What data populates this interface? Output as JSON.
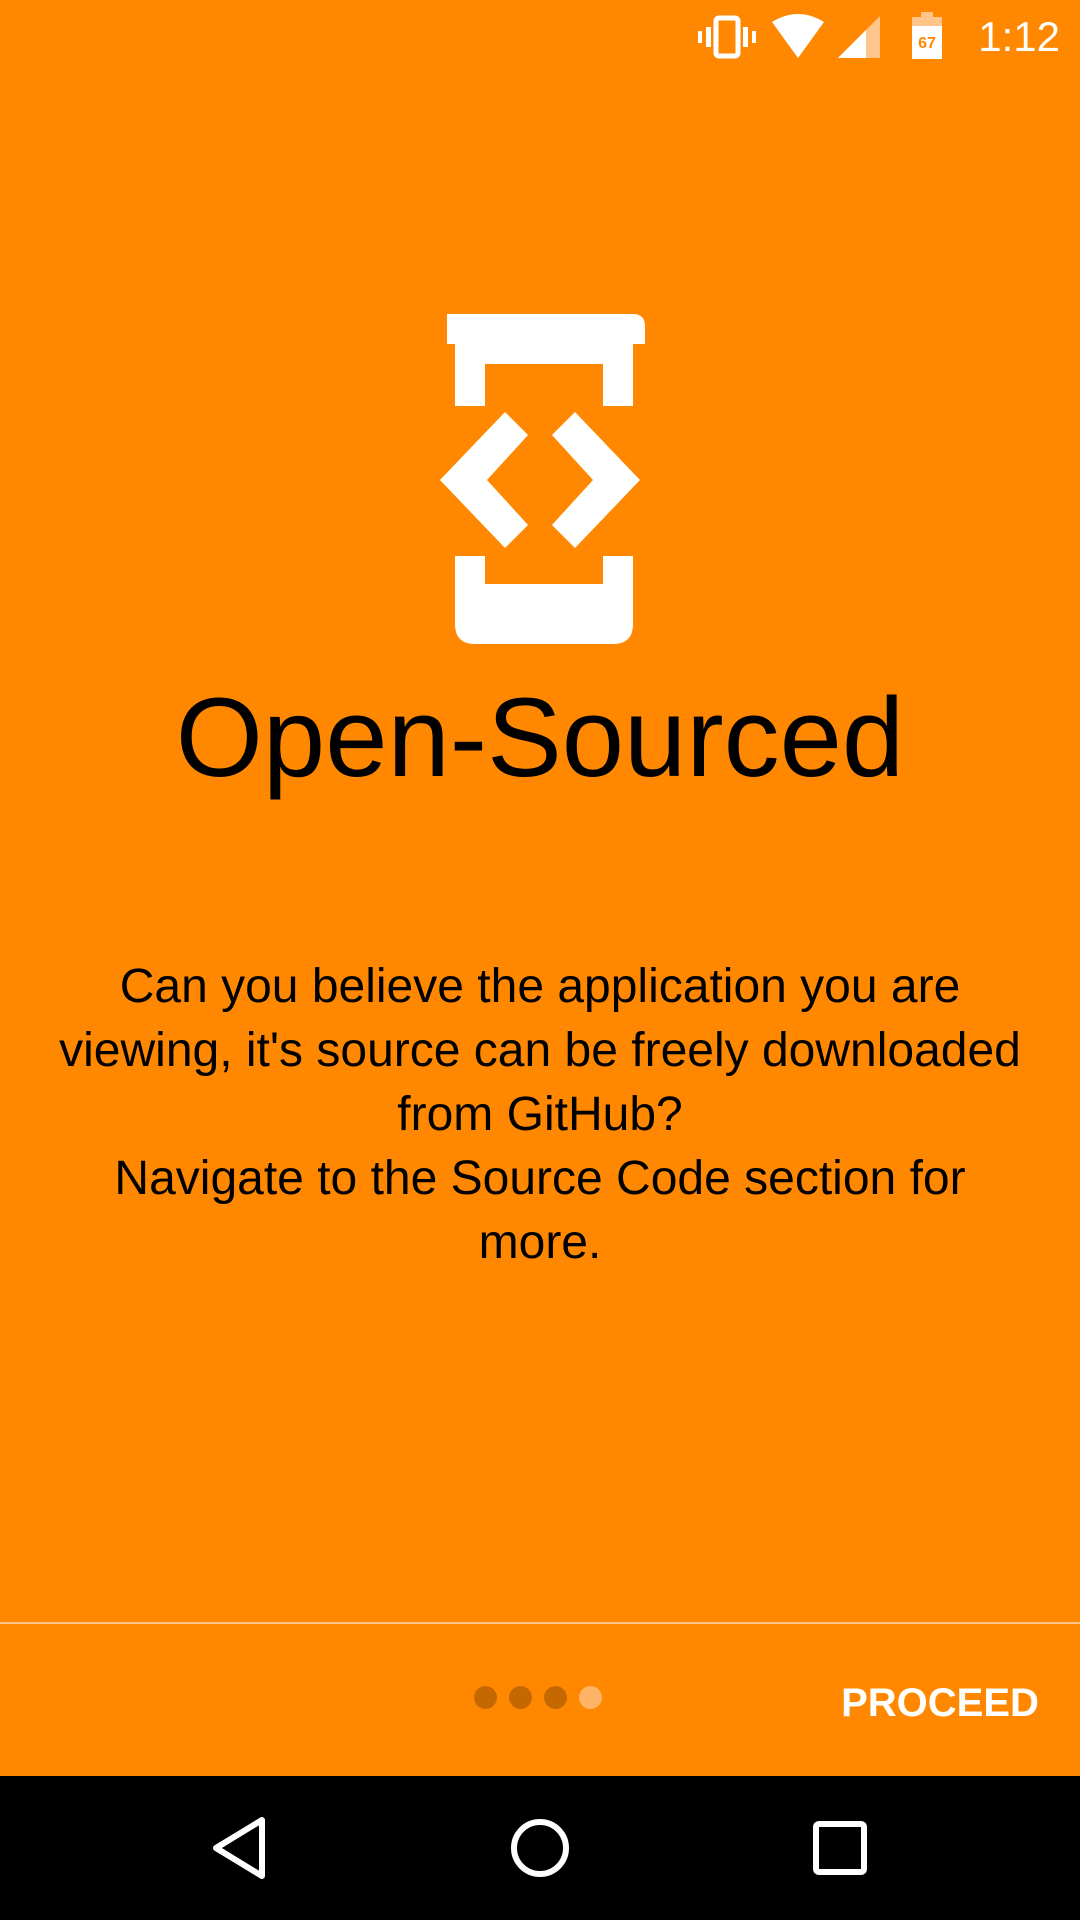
{
  "status_bar": {
    "time": "1:12",
    "battery_level": "67",
    "icons": [
      "vibrate-icon",
      "wifi-icon",
      "signal-icon",
      "battery-icon"
    ]
  },
  "hero": {
    "icon": "developer-mode-icon",
    "title": "Open-Sourced"
  },
  "description": {
    "line1": "Can you believe the application you are viewing, it's source can be freely downloaded from GitHub?",
    "line2": "Navigate to the Source Code section for more."
  },
  "pager": {
    "total_pages": 4,
    "current_page": 4
  },
  "footer": {
    "proceed_label": "PROCEED"
  },
  "nav_bar": {
    "icons": [
      "back-icon",
      "home-icon",
      "recents-icon"
    ]
  },
  "colors": {
    "background": "#FF8800",
    "text": "#000000",
    "accent_text": "#FFFFFF",
    "nav_bar": "#000000"
  }
}
